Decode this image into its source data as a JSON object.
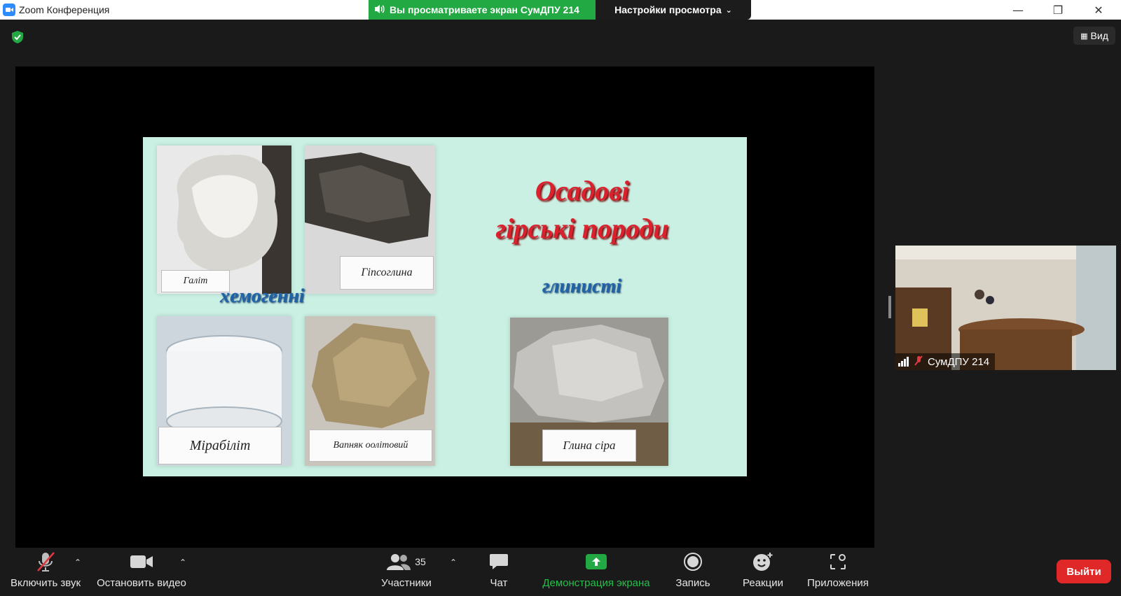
{
  "window": {
    "title": "Zoom Конференция",
    "minimize": "—",
    "restore": "❐",
    "close": "✕"
  },
  "share_banner": {
    "text": "Вы просматриваете экран СумДПУ 214",
    "view_options": "Настройки просмотра"
  },
  "view_button": {
    "label": "Вид"
  },
  "slide": {
    "title_line1": "Осадові",
    "title_line2": "гірські породи",
    "category_chemogenic": "хемогенні",
    "category_clay": "глинисті",
    "samples": [
      {
        "label": "Галіт"
      },
      {
        "label": "Гіпсоглина"
      },
      {
        "label": "Мірабіліт"
      },
      {
        "label": "Вапняк оолітовий"
      },
      {
        "label": "Глина сіра"
      }
    ]
  },
  "participant": {
    "name": "СумДПУ 214"
  },
  "toolbar": {
    "audio_label": "Включить звук",
    "video_label": "Остановить видео",
    "participants_label": "Участники",
    "participants_count": "35",
    "chat_label": "Чат",
    "share_label": "Демонстрация экрана",
    "record_label": "Запись",
    "reactions_label": "Реакции",
    "apps_label": "Приложения",
    "leave_label": "Выйти"
  },
  "colors": {
    "accent_green": "#23a943",
    "leave_red": "#e02828",
    "slide_bg": "#c9f0e3",
    "title_red": "#d9222e",
    "category_blue": "#2163a8"
  }
}
